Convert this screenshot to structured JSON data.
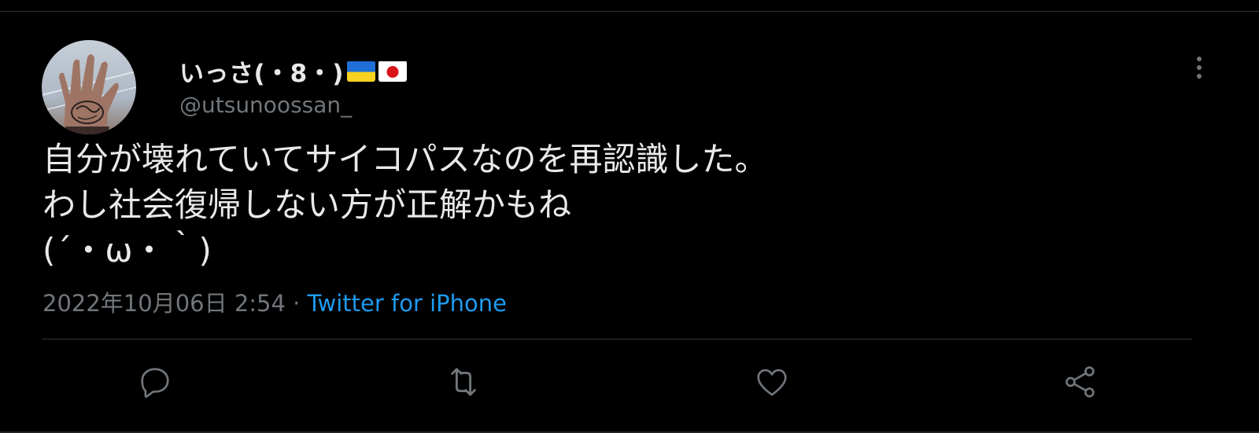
{
  "tweet": {
    "display_name": "いっさ(・8・)",
    "flags": [
      "ukraine-flag",
      "japan-flag"
    ],
    "handle": "@utsunoossan_",
    "text_lines": [
      "自分が壊れていてサイコパスなのを再認識した。",
      "わし社会復帰しない方が正解かもね",
      "(´・ω・｀)"
    ],
    "timestamp": "2022年10月06日 2:54",
    "separator": " · ",
    "source": "Twitter for iPhone"
  },
  "actions": [
    {
      "name": "reply",
      "icon": "reply-icon"
    },
    {
      "name": "retweet",
      "icon": "retweet-icon"
    },
    {
      "name": "like",
      "icon": "heart-icon"
    },
    {
      "name": "share",
      "icon": "share-icon"
    }
  ],
  "colors": {
    "background": "#000000",
    "text": "#e7e9ea",
    "secondary": "#71767b",
    "link": "#1d9bf0",
    "divider": "#2f3336"
  }
}
